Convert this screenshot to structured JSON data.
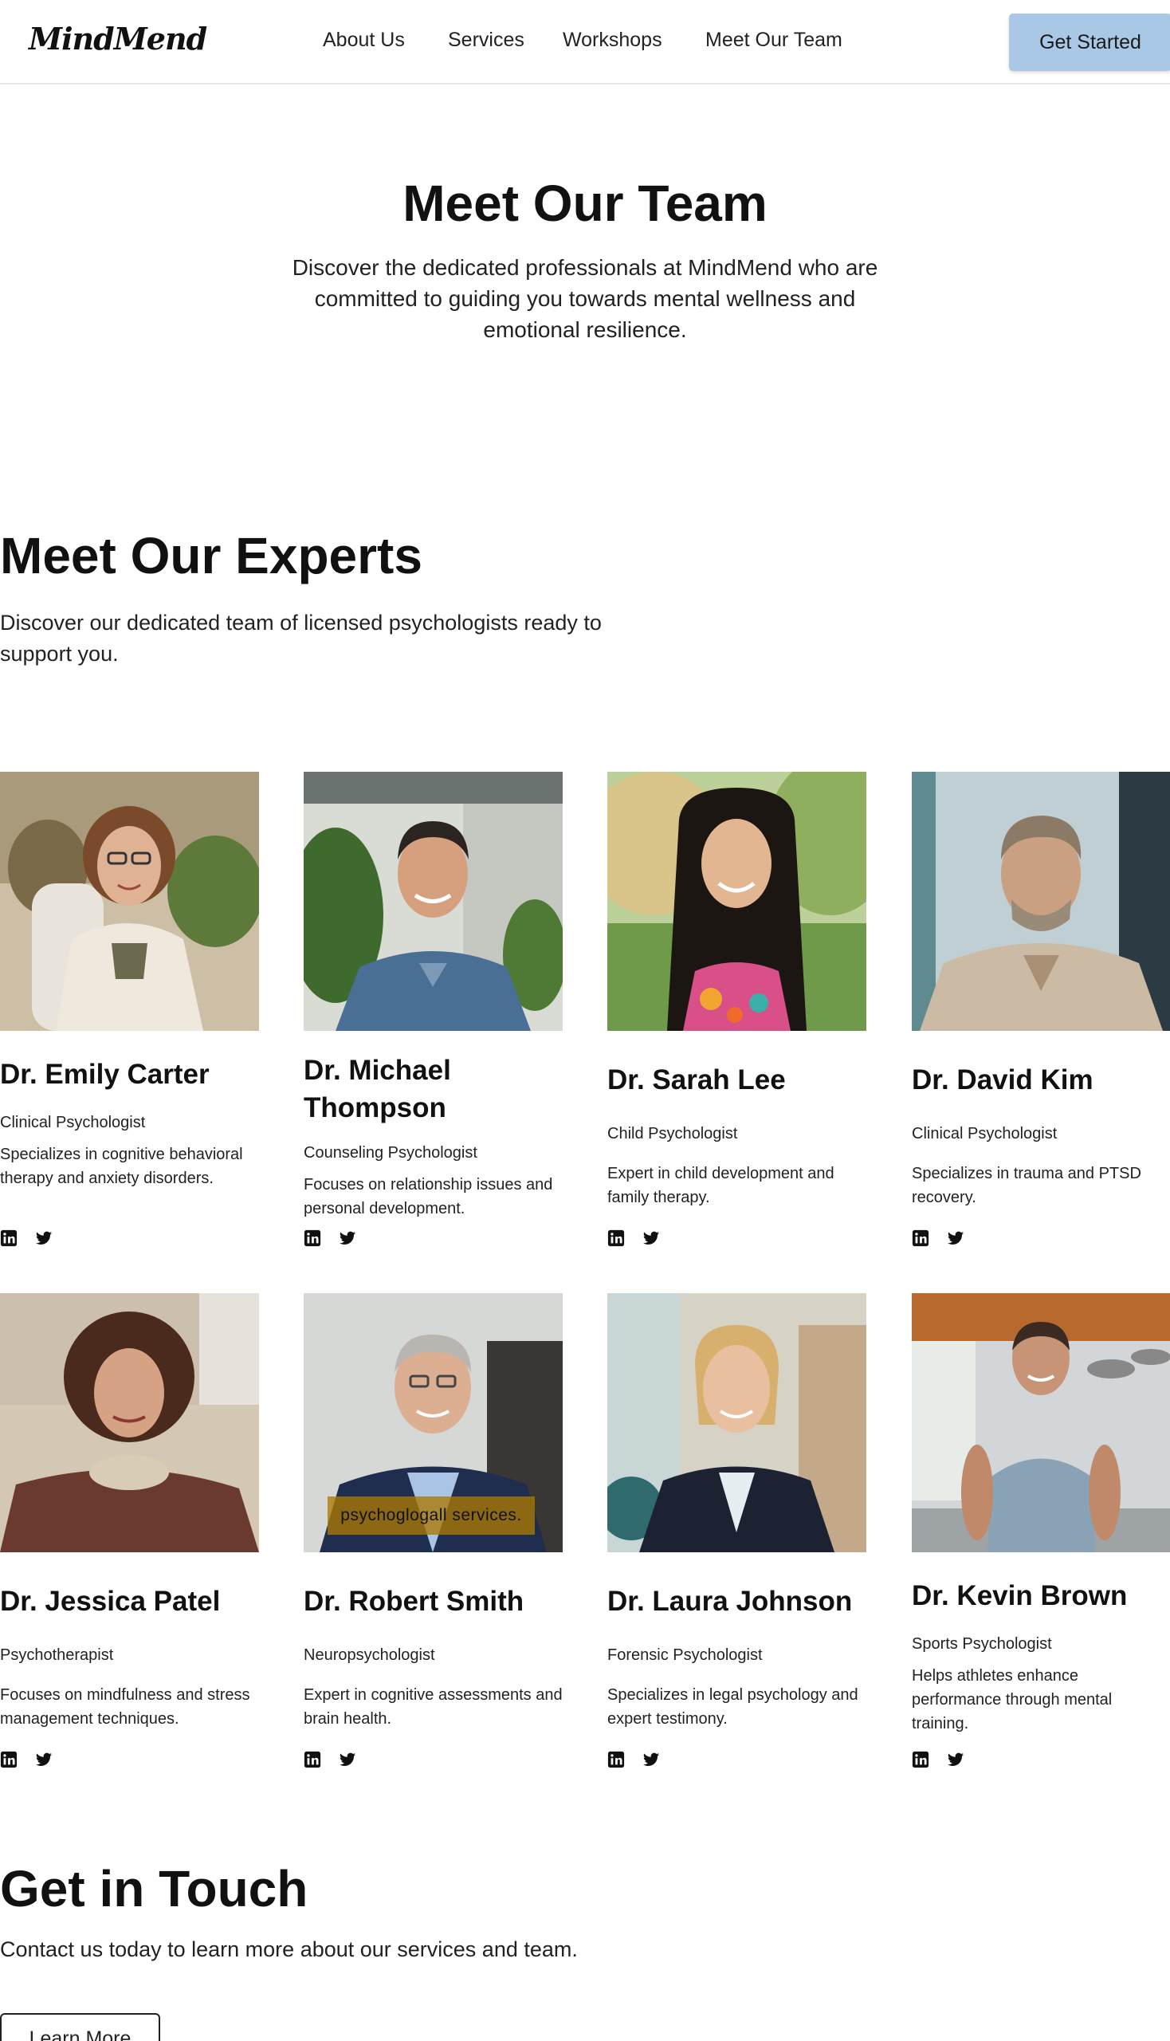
{
  "header": {
    "logo": "MindMend",
    "nav": [
      "About Us",
      "Services",
      "Workshops",
      "Meet Our Team"
    ],
    "cta_label": "Get Started"
  },
  "hero": {
    "title": "Meet Our Team",
    "subtitle": "Discover the dedicated professionals at MindMend who are committed to guiding you towards mental wellness and emotional resilience."
  },
  "experts": {
    "title": "Meet Our Experts",
    "subtitle": "Discover our dedicated team of licensed psychologists ready to support you.",
    "members": [
      {
        "name": "Dr. Emily Carter",
        "role": "Clinical Psychologist",
        "desc": "Specializes in cognitive behavioral therapy and anxiety disorders."
      },
      {
        "name": "Dr. Michael Thompson",
        "role": "Counseling Psychologist",
        "desc": "Focuses on relationship issues and personal development."
      },
      {
        "name": "Dr. Sarah Lee",
        "role": "Child Psychologist",
        "desc": "Expert in child development and family therapy."
      },
      {
        "name": "Dr. David Kim",
        "role": "Clinical Psychologist",
        "desc": "Specializes in trauma and PTSD recovery."
      },
      {
        "name": "Dr. Jessica Patel",
        "role": "Psychotherapist",
        "desc": "Focuses on mindfulness and stress management techniques."
      },
      {
        "name": "Dr. Robert Smith",
        "role": "Neuropsychologist",
        "desc": "Expert in cognitive assessments and brain health.",
        "photo_caption": "psychoglogall services."
      },
      {
        "name": "Dr. Laura Johnson",
        "role": "Forensic Psychologist",
        "desc": "Specializes in legal psychology and expert testimony."
      },
      {
        "name": "Dr. Kevin Brown",
        "role": "Sports Psychologist",
        "desc": "Helps athletes enhance performance through mental training."
      }
    ]
  },
  "contact": {
    "title": "Get in Touch",
    "subtitle": "Contact us today to learn more about our services and team.",
    "button_label": "Learn More"
  },
  "icons": {
    "social": [
      "linkedin-icon",
      "twitter-icon"
    ]
  },
  "colors": {
    "cta_bg": "#a9c8e6",
    "text": "#111111",
    "border": "#e6e6e6"
  }
}
